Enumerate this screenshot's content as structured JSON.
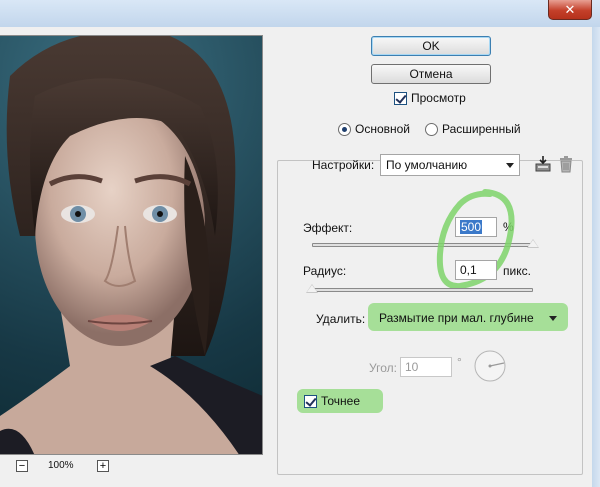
{
  "window": {
    "close_glyph": "✕"
  },
  "preview": {
    "zoom_out": "−",
    "zoom_level": "100%",
    "zoom_in": "+"
  },
  "buttons": {
    "ok": "OK",
    "cancel": "Отмена"
  },
  "preview_toggle": {
    "label": "Просмотр",
    "checked": true
  },
  "mode": {
    "basic": "Основной",
    "advanced": "Расширенный",
    "selected": "basic"
  },
  "settings": {
    "label": "Настройки:",
    "value": "По умолчанию"
  },
  "amount": {
    "label": "Эффект:",
    "value": "500",
    "unit": "%",
    "fraction": 1.0
  },
  "radius": {
    "label": "Радиус:",
    "value": "0,1",
    "unit": "пикс.",
    "fraction": 0.0
  },
  "remove": {
    "label": "Удалить:",
    "value": "Размытие при мал. глубине"
  },
  "angle": {
    "label": "Угол:",
    "value": "10",
    "unit": "°"
  },
  "more_accurate": {
    "label": "Точнее",
    "checked": true
  },
  "colors": {
    "highlight": "#9ddd8e",
    "circle_marker": "#7ed36a",
    "close_button": "#c4402a"
  }
}
